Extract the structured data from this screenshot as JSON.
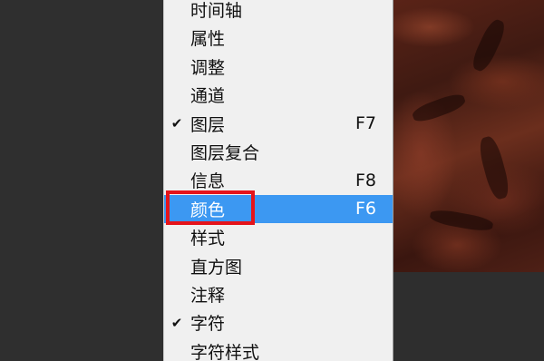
{
  "menu": {
    "items": [
      {
        "label": "时间轴",
        "shortcut": "",
        "checked": false,
        "highlighted": false
      },
      {
        "label": "属性",
        "shortcut": "",
        "checked": false,
        "highlighted": false
      },
      {
        "label": "调整",
        "shortcut": "",
        "checked": false,
        "highlighted": false
      },
      {
        "label": "通道",
        "shortcut": "",
        "checked": false,
        "highlighted": false
      },
      {
        "label": "图层",
        "shortcut": "F7",
        "checked": true,
        "highlighted": false
      },
      {
        "label": "图层复合",
        "shortcut": "",
        "checked": false,
        "highlighted": false
      },
      {
        "label": "信息",
        "shortcut": "F8",
        "checked": false,
        "highlighted": false
      },
      {
        "label": "颜色",
        "shortcut": "F6",
        "checked": false,
        "highlighted": true
      },
      {
        "label": "样式",
        "shortcut": "",
        "checked": false,
        "highlighted": false
      },
      {
        "label": "直方图",
        "shortcut": "",
        "checked": false,
        "highlighted": false
      },
      {
        "label": "注释",
        "shortcut": "",
        "checked": false,
        "highlighted": false
      },
      {
        "label": "字符",
        "shortcut": "",
        "checked": true,
        "highlighted": false
      },
      {
        "label": "字符样式",
        "shortcut": "",
        "checked": false,
        "highlighted": false
      }
    ],
    "check_glyph": "✔"
  },
  "colors": {
    "highlight": "#3c98f2",
    "annotation": "#e5141b",
    "menu_bg": "#f0f0f0"
  }
}
